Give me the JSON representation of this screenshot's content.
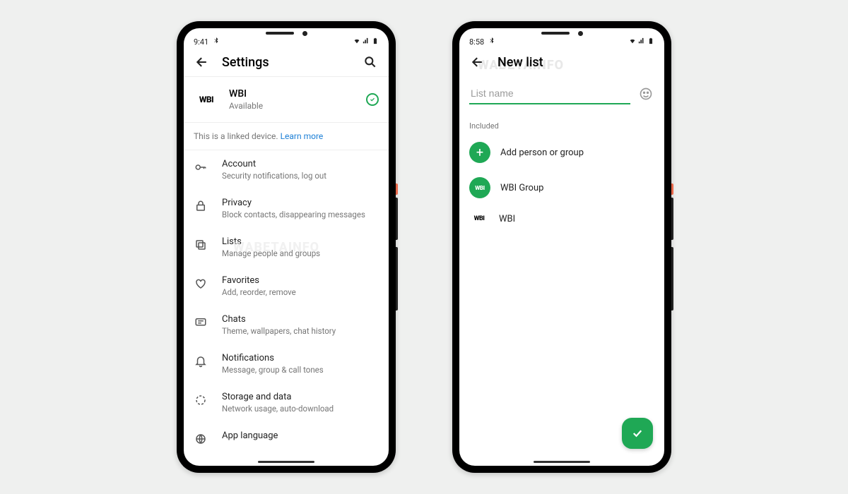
{
  "phone1": {
    "time": "9:41",
    "title": "Settings",
    "profile": {
      "name": "WBI",
      "status": "Available"
    },
    "linked_notice": "This is a linked device. ",
    "learn_more": "Learn more",
    "items": [
      {
        "title": "Account",
        "sub": "Security notifications, log out"
      },
      {
        "title": "Privacy",
        "sub": "Block contacts, disappearing messages"
      },
      {
        "title": "Lists",
        "sub": "Manage people and groups"
      },
      {
        "title": "Favorites",
        "sub": "Add, reorder, remove"
      },
      {
        "title": "Chats",
        "sub": "Theme, wallpapers, chat history"
      },
      {
        "title": "Notifications",
        "sub": "Message, group & call tones"
      },
      {
        "title": "Storage and data",
        "sub": "Network usage, auto-download"
      },
      {
        "title": "App language",
        "sub": ""
      }
    ]
  },
  "phone2": {
    "time": "8:58",
    "title": "New list",
    "input_placeholder": "List name",
    "section": "Included",
    "add_label": "Add person or group",
    "items": [
      {
        "label": "WBI Group"
      },
      {
        "label": "WBI"
      }
    ]
  },
  "watermark": "WABETAINFO"
}
